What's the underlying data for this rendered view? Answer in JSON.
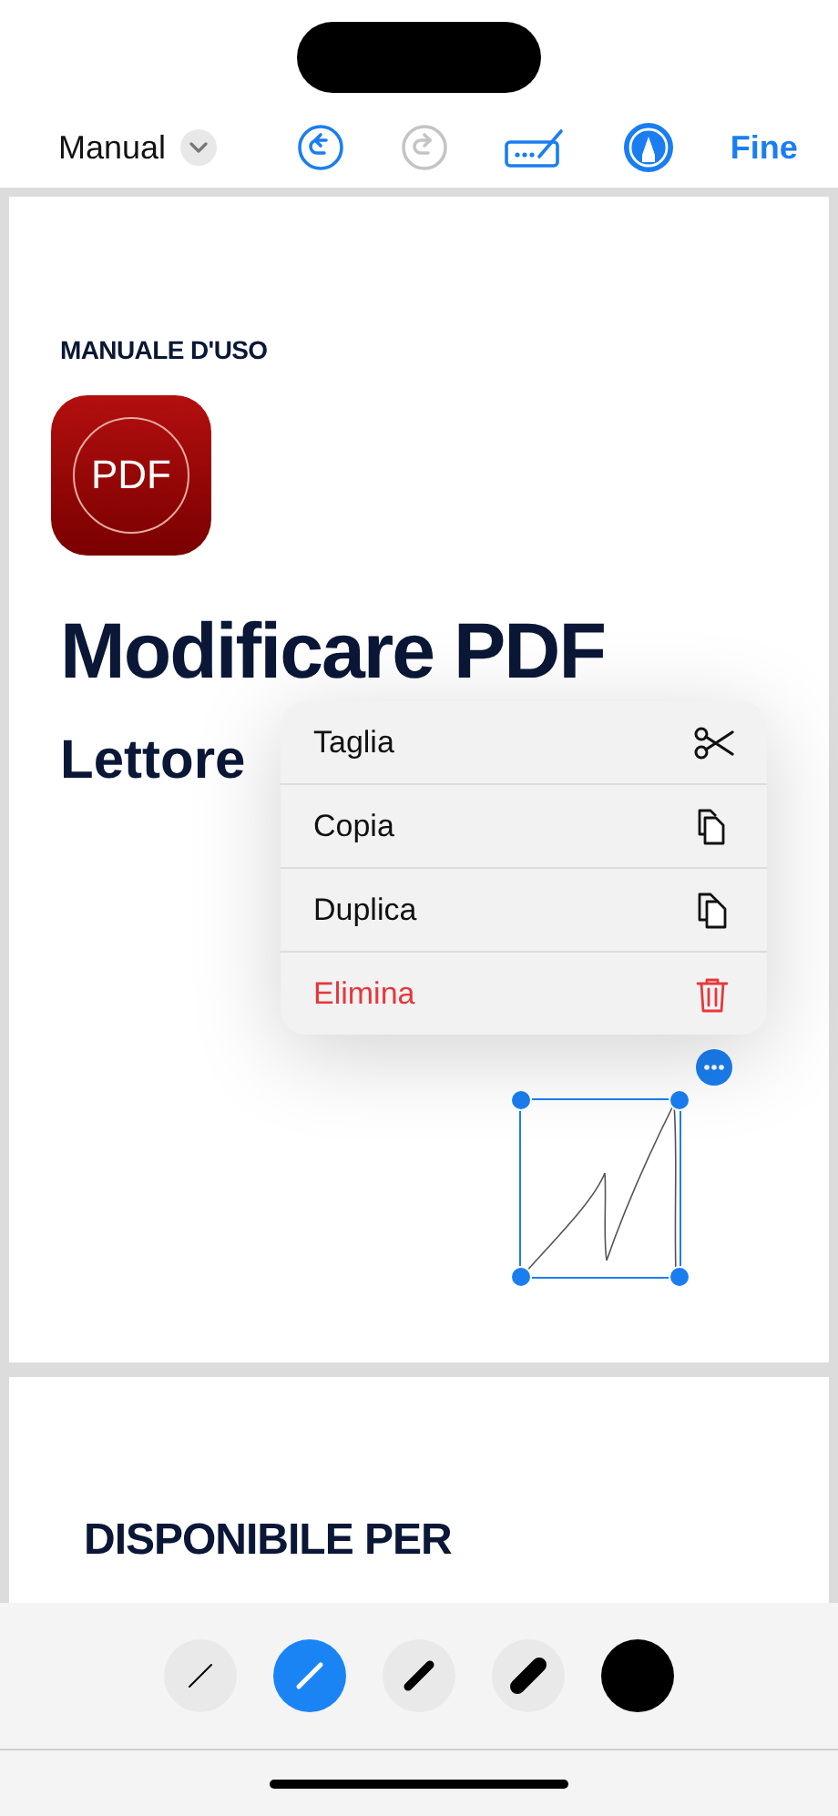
{
  "toolbar": {
    "title": "Manual",
    "undo": {
      "disabled": false
    },
    "redo": {
      "disabled": true
    },
    "markup": {
      "on": true
    },
    "done": "Fine"
  },
  "page": {
    "eyebrow": "MANUALE D'USO",
    "app_icon": "PDF",
    "heading": "Modificare PDF",
    "subheading": "Lettore"
  },
  "context_menu": {
    "items": [
      {
        "label": "Taglia",
        "kind": "cut"
      },
      {
        "label": "Copia",
        "kind": "copy"
      },
      {
        "label": "Duplica",
        "kind": "duplicate"
      },
      {
        "label": "Elimina",
        "kind": "delete"
      }
    ]
  },
  "next_page": {
    "heading": "DISPONIBILE PER"
  },
  "pens": [
    {
      "selected": false
    },
    {
      "selected": true
    },
    {
      "selected": false
    },
    {
      "selected": false
    }
  ],
  "swatch": {
    "color": "#000000"
  }
}
